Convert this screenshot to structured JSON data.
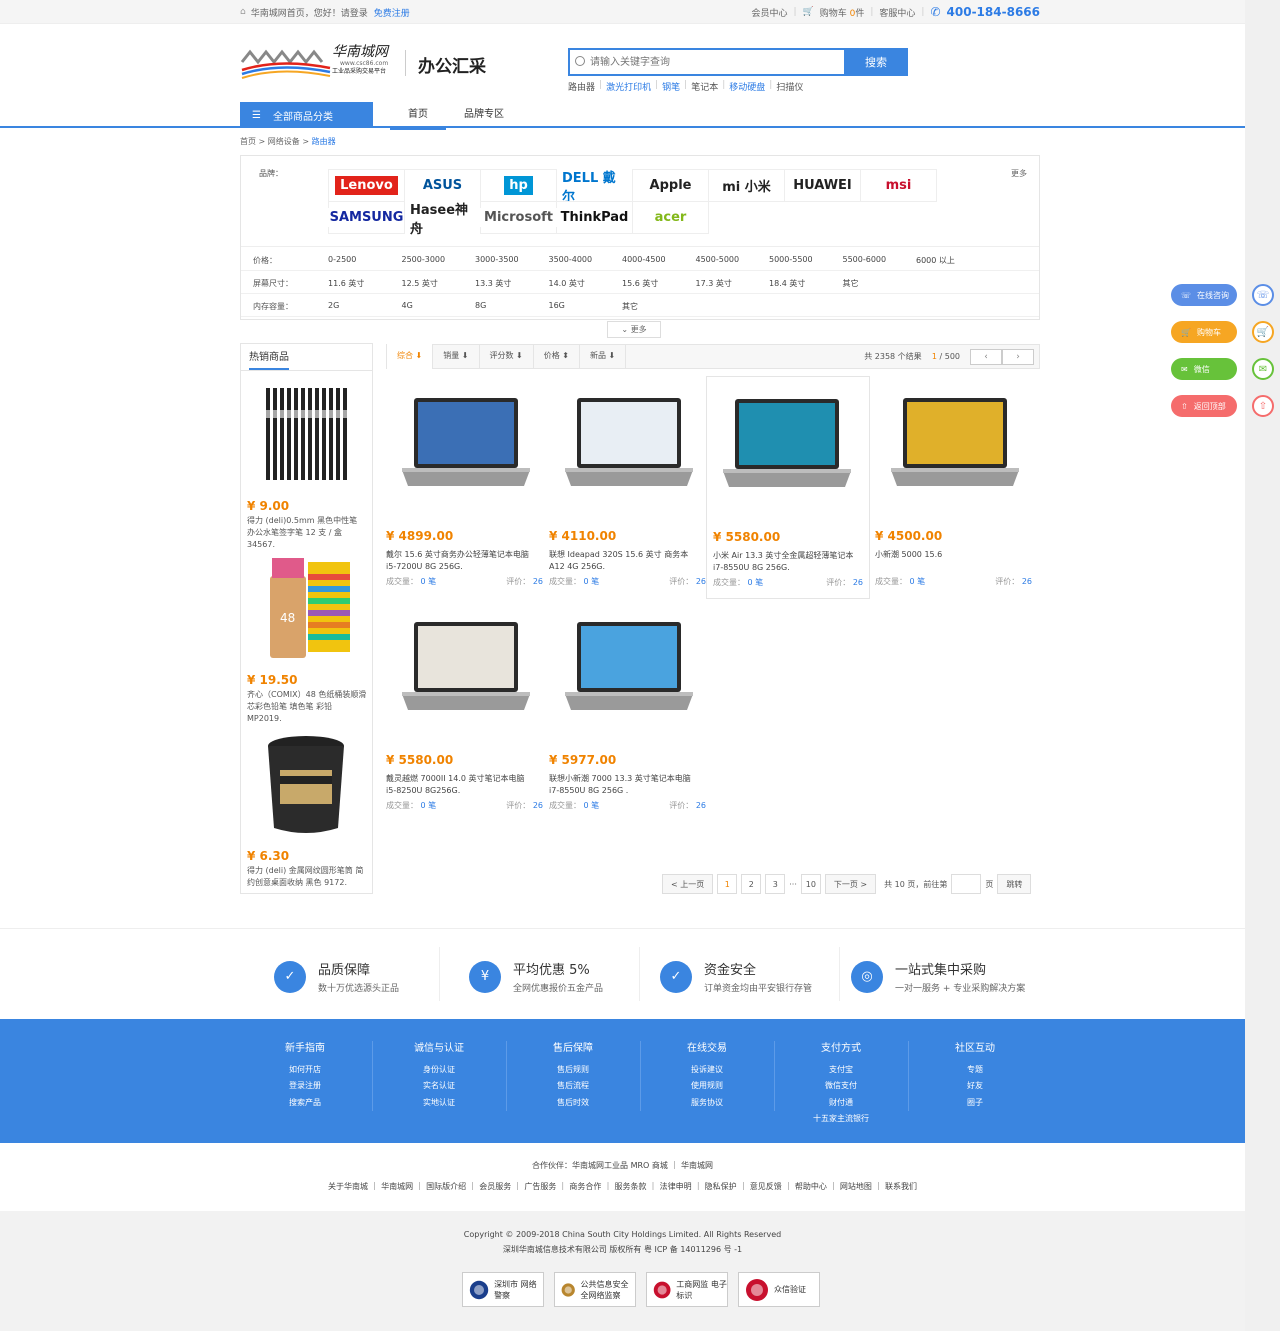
{
  "topbar": {
    "home": "华南城网首页，",
    "hello": "您好！请登录",
    "register": "免费注册",
    "member": "会员中心",
    "cart": "购物车",
    "cart_count": "0",
    "cart_unit": "件",
    "service": "客服中心",
    "phone": "400-184-8666"
  },
  "header": {
    "logo_text": "华南城网",
    "logo_url": "www.csc86.com",
    "logo_slogan": "工业品采购交易平台",
    "sub_brand": "办公汇采",
    "search_placeholder": "请输入关键字查询",
    "search_button": "搜索",
    "hotwords": [
      {
        "t": "路由器",
        "hl": false
      },
      {
        "t": "激光打印机",
        "hl": true
      },
      {
        "t": "钢笔",
        "hl": true
      },
      {
        "t": "笔记本",
        "hl": false
      },
      {
        "t": "移动硬盘",
        "hl": true
      },
      {
        "t": "扫描仪",
        "hl": false
      }
    ]
  },
  "nav": {
    "category_button": "全部商品分类",
    "items": [
      "首页",
      "品牌专区"
    ]
  },
  "breadcrumb": {
    "a": "首页",
    "b": "网络设备",
    "c": "路由器"
  },
  "filter": {
    "brand_label": "品牌：",
    "more": "更多",
    "brands": [
      {
        "t": "Lenovo",
        "c": "#fff",
        "bg": "#e2231a"
      },
      {
        "t": "ASUS",
        "c": "#00539b",
        "bg": "#fff"
      },
      {
        "t": "hp",
        "c": "#fff",
        "bg": "#0096d6"
      },
      {
        "t": "DELL 戴尔",
        "c": "#0076ce",
        "bg": "#fff"
      },
      {
        "t": "Apple",
        "c": "#222",
        "bg": "#fff"
      },
      {
        "t": "mi 小米",
        "c": "#222",
        "bg": "#fff"
      },
      {
        "t": "HUAWEI",
        "c": "#222",
        "bg": "#fff"
      },
      {
        "t": "msi",
        "c": "#c8102e",
        "bg": "#fff"
      },
      {
        "t": "SAMSUNG",
        "c": "#1428a0",
        "bg": "#fff"
      },
      {
        "t": "Hasee神舟",
        "c": "#222",
        "bg": "#fff"
      },
      {
        "t": "Microsoft",
        "c": "#555",
        "bg": "#fff"
      },
      {
        "t": "ThinkPad",
        "c": "#111",
        "bg": "#fff"
      },
      {
        "t": "acer",
        "c": "#83b81a",
        "bg": "#fff"
      }
    ],
    "rows": [
      {
        "label": "价格：",
        "opts": [
          "0-2500",
          "2500-3000",
          "3000-3500",
          "3500-4000",
          "4000-4500",
          "4500-5000",
          "5000-5500",
          "5500-6000",
          "6000 以上"
        ]
      },
      {
        "label": "屏幕尺寸：",
        "opts": [
          "11.6 英寸",
          "12.5 英寸",
          "13.3 英寸",
          "14.0 英寸",
          "15.6 英寸",
          "17.3 英寸",
          "18.4 英寸",
          "其它"
        ]
      },
      {
        "label": "内存容量：",
        "opts": [
          "2G",
          "4G",
          "8G",
          "16G",
          "其它"
        ]
      }
    ],
    "expand": "更多"
  },
  "hot": {
    "title": "热销商品",
    "items": [
      {
        "price": "¥ 9.00",
        "name": "得力 (deli)0.5mm 黑色中性笔 办公水笔签字笔 12 支 / 盒 34567."
      },
      {
        "price": "¥ 19.50",
        "name": "齐心（COMIX）48 色纸桶装顺滑芯彩色铅笔 填色笔 彩铅 MP2019."
      },
      {
        "price": "¥ 6.30",
        "name": "得力 (deli) 金属网纹圆形笔筒 简约创意桌面收纳 黑色 9172."
      }
    ]
  },
  "sort": {
    "items": [
      "综合",
      "销量",
      "评分数",
      "价格",
      "新品"
    ],
    "total_prefix": "共",
    "total": "2358",
    "total_suffix": "个结果",
    "page": "1",
    "pages": "/ 500"
  },
  "products": [
    {
      "price": "¥ 4899.00",
      "name": "戴尔 15.6 英寸商务办公轻薄笔记本电脑 i5-7200U 8G 256G.",
      "deal_label": "成交量：",
      "deal": "0 笔",
      "rev_label": "评价：",
      "rev": "26"
    },
    {
      "price": "¥ 4110.00",
      "name": "联想 Ideapad 320S 15.6 英寸 商务本 A12 4G 256G.",
      "deal_label": "成交量：",
      "deal": "0 笔",
      "rev_label": "评价：",
      "rev": "26"
    },
    {
      "price": "¥ 5580.00",
      "name": "小米 Air 13.3 英寸全金属超轻薄笔记本 i7-8550U 8G 256G.",
      "deal_label": "成交量：",
      "deal": "0 笔",
      "rev_label": "评价：",
      "rev": "26"
    },
    {
      "price": "¥ 4500.00",
      "name": "小新潮 5000 15.6",
      "deal_label": "成交量：",
      "deal": "0 笔",
      "rev_label": "评价：",
      "rev": "26"
    },
    {
      "price": "¥ 5580.00",
      "name": "戴灵越燃 7000II 14.0 英寸笔记本电脑 i5-8250U 8G256G.",
      "deal_label": "成交量：",
      "deal": "0 笔",
      "rev_label": "评价：",
      "rev": "26"
    },
    {
      "price": "¥ 5977.00",
      "name": "联想小新潮 7000 13.3 英寸笔记本电脑 i7-8550U 8G 256G .",
      "deal_label": "成交量：",
      "deal": "0 笔",
      "rev_label": "评价：",
      "rev": "26"
    }
  ],
  "pager": {
    "prev": "< 上一页",
    "pages": [
      "1",
      "2",
      "3"
    ],
    "ellipsis": "···",
    "last": "10",
    "next": "下一页 >",
    "total": "共 10 页，前往第",
    "unit": "页",
    "go": "跳转"
  },
  "float": [
    {
      "t": "在线咨询",
      "c": "#5b8ee6"
    },
    {
      "t": "购物车",
      "c": "#f6a623"
    },
    {
      "t": "微信",
      "c": "#67c23a"
    },
    {
      "t": "返回顶部",
      "c": "#f56c6c"
    }
  ],
  "features": [
    {
      "icon": "✓",
      "t1": "品质保障",
      "t2": "数十万优选源头正品"
    },
    {
      "icon": "¥",
      "t1": "平均优惠 5%",
      "t2": "全网优惠报价五金产品"
    },
    {
      "icon": "✓",
      "t1": "资金安全",
      "t2": "订单资金均由平安银行存管"
    },
    {
      "icon": "◎",
      "t1": "一站式集中采购",
      "t2": "一对一服务 + 专业采购解决方案"
    }
  ],
  "footer_cols": [
    {
      "h": "新手指南",
      "items": [
        "如何开店",
        "登录注册",
        "搜索产品"
      ]
    },
    {
      "h": "诚信与认证",
      "items": [
        "身份认证",
        "实名认证",
        "实地认证"
      ]
    },
    {
      "h": "售后保障",
      "items": [
        "售后规则",
        "售后流程",
        "售后时效"
      ]
    },
    {
      "h": "在线交易",
      "items": [
        "投诉建议",
        "使用规则",
        "服务协议"
      ]
    },
    {
      "h": "支付方式",
      "items": [
        "支付宝",
        "微信支付",
        "财付通",
        "十五家主流银行"
      ]
    },
    {
      "h": "社区互动",
      "items": [
        "专题",
        "好友",
        "圈子"
      ]
    }
  ],
  "partners": "合作伙伴：华南城网工业品 MRO 商城 ｜ 华南城网",
  "links": "关于华南城 ｜ 华南城网 ｜ 国际版介绍 ｜ 会员服务 ｜ 广告服务 ｜ 商务合作 ｜ 服务条款 ｜ 法律申明 ｜ 隐私保护 ｜ 意见反馈 ｜ 帮助中心 ｜ 网站地图 ｜ 联系我们",
  "copyright": "Copyright © 2009-2018 China South City Holdings Limited. All Rights Reserved",
  "icp": "深圳华南城信息技术有限公司 版权所有 粤 ICP 备 14011296 号 -1",
  "badges": [
    {
      "t": "深圳市 网络警察",
      "c": "#1a3e8c"
    },
    {
      "t": "公共信息安全 全网络监察",
      "c": "#b8862e"
    },
    {
      "t": "工商网监 电子标识",
      "c": "#c8102e"
    },
    {
      "t": "众信验证",
      "c": "#c8102e"
    }
  ]
}
